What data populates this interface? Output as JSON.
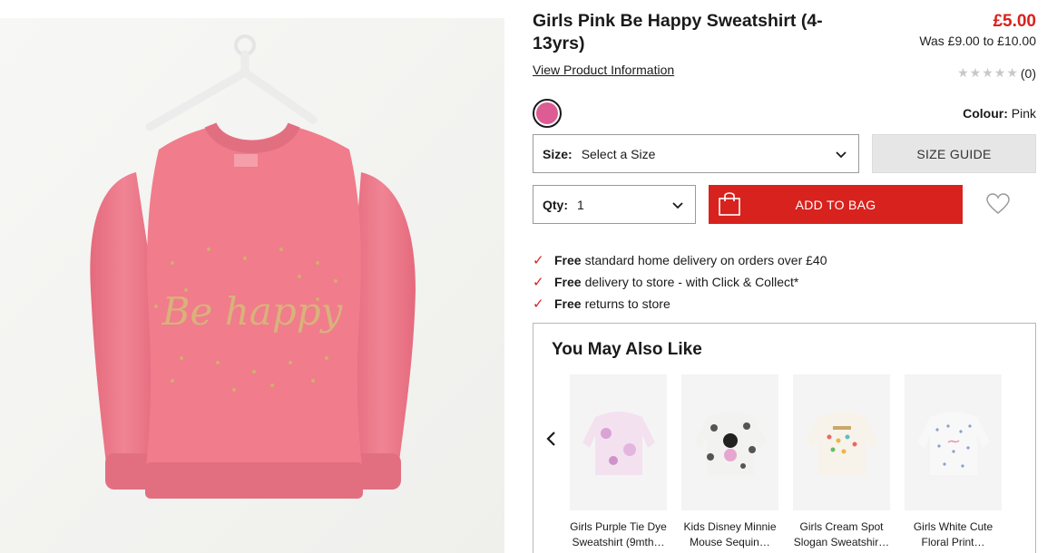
{
  "product": {
    "title": "Girls Pink Be Happy Sweatshirt (4-13yrs)",
    "price": "£5.00",
    "was_price": "Was £9.00 to £10.00",
    "view_info_link": "View Product Information",
    "rating_count": "(0)",
    "rating_stars": 0,
    "image_print_text": "Be happy"
  },
  "colour": {
    "label": "Colour:",
    "value": "Pink",
    "swatch_hex": "#dc5c93"
  },
  "size": {
    "label": "Size:",
    "value": "Select a Size",
    "guide_label": "SIZE GUIDE"
  },
  "qty": {
    "label": "Qty:",
    "value": "1"
  },
  "add_to_bag_label": "ADD TO BAG",
  "benefits": [
    {
      "bold": "Free",
      "text": "standard home delivery on orders over £40"
    },
    {
      "bold": "Free",
      "text": "delivery to store - with Click & Collect*"
    },
    {
      "bold": "Free",
      "text": "returns to store"
    }
  ],
  "you_may_also_like": {
    "title": "You May Also Like",
    "items": [
      {
        "name": "Girls Purple Tie Dye Sweatshirt (9mth…"
      },
      {
        "name": "Kids Disney Minnie Mouse Sequin…"
      },
      {
        "name": "Girls Cream Spot Slogan Sweatshir…"
      },
      {
        "name": "Girls White Cute Floral Print…"
      }
    ]
  },
  "colors": {
    "accent_red": "#d8221e",
    "sweatshirt_pink": "#ef7f8f"
  }
}
